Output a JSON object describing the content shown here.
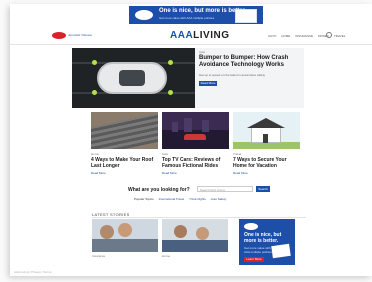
{
  "top_ad": {
    "headline": "One is nice, but more is better.",
    "subtext": "Get more value with AAA multiple policies"
  },
  "nav": {
    "member_link": "Join AAA / Renew",
    "site_title_prefix": "AAA",
    "site_title_suffix": "LIVING",
    "menu": [
      "AUTO",
      "HOME",
      "INSURANCE",
      "MONEY",
      "TRAVEL"
    ]
  },
  "hero": {
    "category": "Auto",
    "headline": "Bumper to Bumper: How Crash Avoidance Technology Works",
    "subtext": "Get up to speed on the latest in automotive safety",
    "button": "Read More"
  },
  "cards": [
    {
      "category": "Home",
      "title": "4 Ways to Make Your Roof Last Longer",
      "more": "Read More"
    },
    {
      "category": "Auto",
      "title": "Top TV Cars: Reviews of Famous Fictional Rides",
      "more": "Read More"
    },
    {
      "category": "Travel",
      "title": "7 Ways to Secure Your Home for Vacation",
      "more": "Read More"
    }
  ],
  "search": {
    "question": "What are you looking for?",
    "placeholder": "Search AAA Living",
    "button": "Search",
    "popular_label": "Popular Topics",
    "popular": [
      "International Travel",
      "Trivia Nights",
      "Auto Safety"
    ]
  },
  "latest": {
    "label": "LATEST STORIES",
    "items": [
      {
        "category": "Insurance"
      },
      {
        "category": "Home"
      }
    ]
  },
  "side_ad": {
    "headline": "One is nice, but more is better.",
    "subtext": "Get more value with AAA multiple policies",
    "cta": "Learn More"
  },
  "footer": {
    "text": "AAA Living  |  Privacy  |  Terms"
  },
  "colors": {
    "brand_blue": "#1d4fa8",
    "brand_red": "#d8232a"
  }
}
